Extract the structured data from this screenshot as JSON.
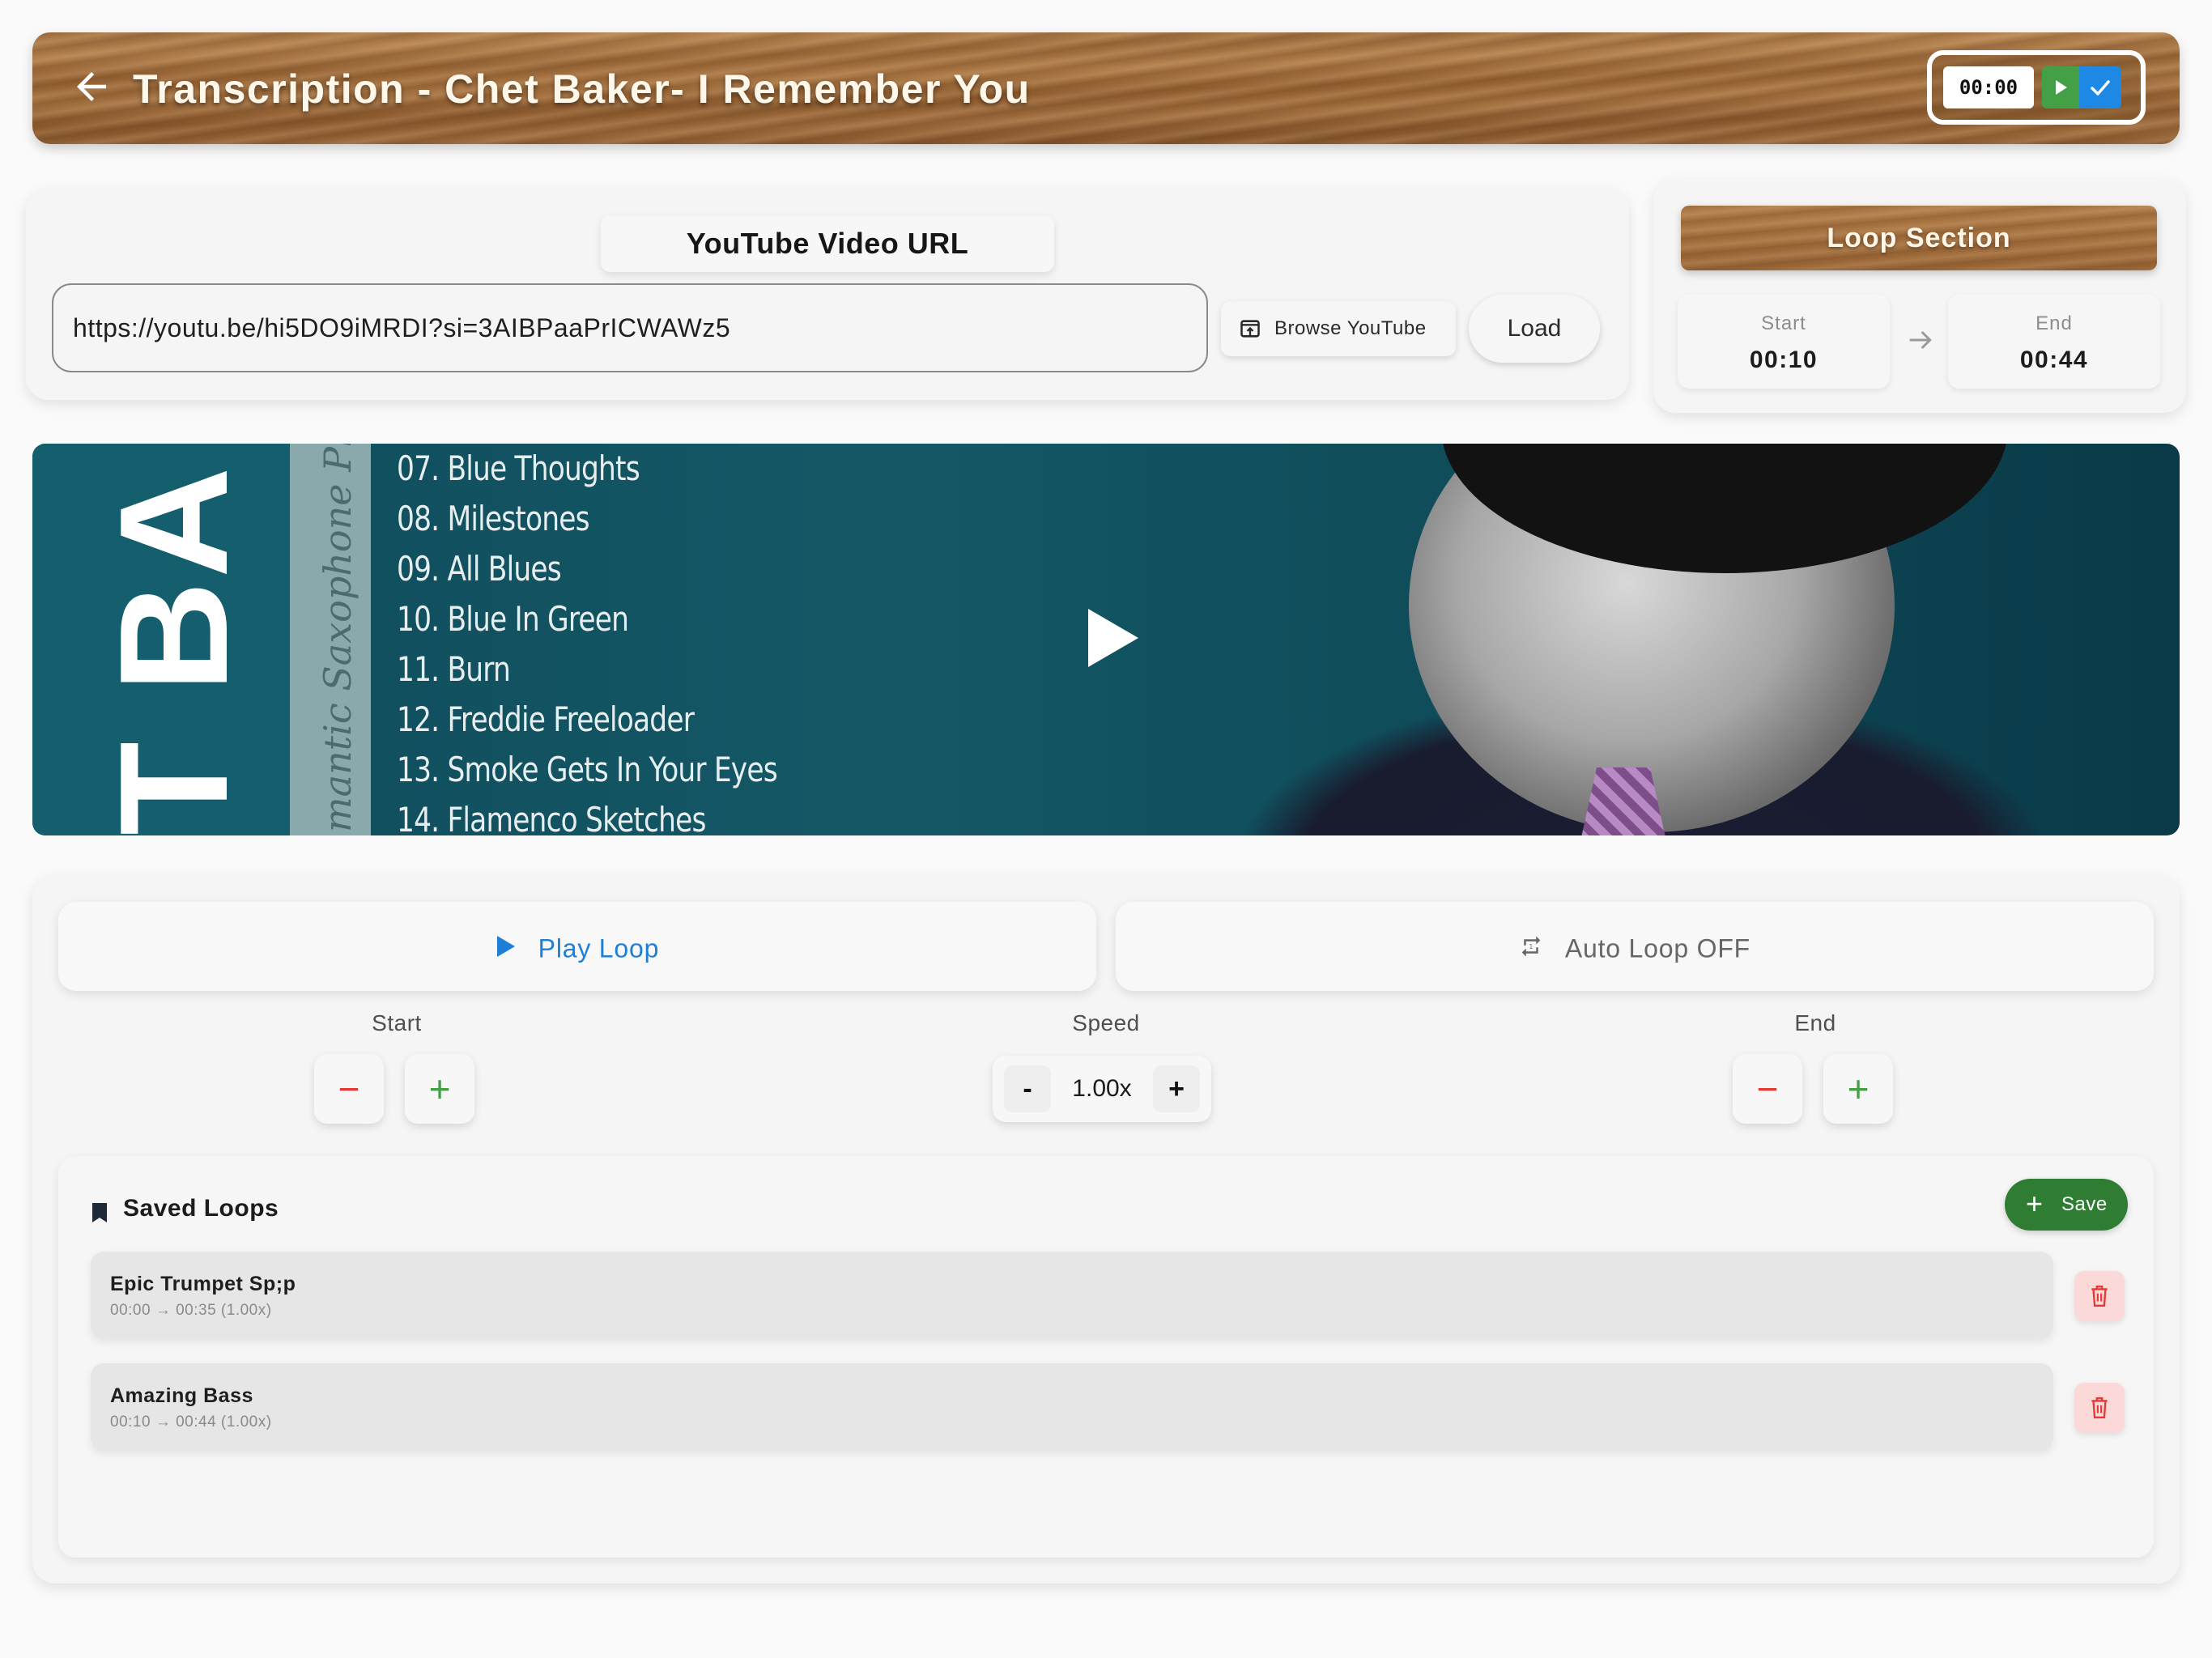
{
  "header": {
    "title": "Transcription - Chet Baker- I Remember You",
    "timer": "00:00"
  },
  "url_panel": {
    "title": "YouTube Video URL",
    "url_value": "https://youtu.be/hi5DO9iMRDI?si=3AIBPaaPrICWAWz5",
    "browse_label": "Browse YouTube",
    "load_label": "Load"
  },
  "loop_section": {
    "title": "Loop Section",
    "start_label": "Start",
    "start_value": "00:10",
    "end_label": "End",
    "end_value": "00:44"
  },
  "video": {
    "vertical_text": "T BA",
    "script_text": "mantic Saxophone Playl",
    "tracks": [
      "07. Blue Thoughts",
      "08. Milestones",
      "09. All Blues",
      "10. Blue In Green",
      "11. Burn",
      "12. Freddie Freeloader",
      "13. Smoke Gets In Your Eyes",
      "14. Flamenco Sketches"
    ]
  },
  "controls": {
    "play_loop_label": "Play Loop",
    "auto_loop_label": "Auto Loop OFF",
    "start_label": "Start",
    "speed_label": "Speed",
    "end_label": "End",
    "speed_value": "1.00x",
    "speed_minus": "-",
    "speed_plus": "+",
    "minus_symbol": "−",
    "plus_symbol": "+"
  },
  "saved_loops": {
    "title": "Saved Loops",
    "save_label": "Save",
    "items": [
      {
        "name": "Epic Trumpet Sp;p",
        "meta": "00:00 → 00:35 (1.00x)"
      },
      {
        "name": "Amazing Bass",
        "meta": "00:10 → 00:44 (1.00x)"
      }
    ]
  },
  "colors": {
    "accent_blue": "#1d7fd6",
    "save_green": "#2e7d32",
    "minus_red": "#e53935",
    "plus_green": "#43a047",
    "delete_bg": "#fbd9d9"
  }
}
